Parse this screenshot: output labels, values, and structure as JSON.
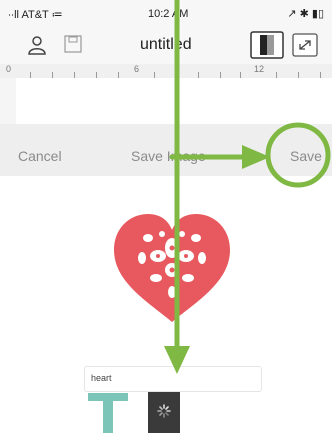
{
  "status_bar": {
    "carrier": "∙∙ll AT&T ≔",
    "time": "10:2 AM",
    "right": "↗ ✱ ▮▯"
  },
  "nav": {
    "title": "untitled"
  },
  "ruler": {
    "labels": [
      "0",
      "6",
      "12"
    ]
  },
  "actions": {
    "cancel": "Cancel",
    "save_image": "Save Image",
    "save": "Save"
  },
  "search": {
    "value": "heart"
  },
  "colors": {
    "annotation_green": "#7fb843",
    "heart_red": "#e7595f",
    "t_teal": "#7bc5b8"
  }
}
